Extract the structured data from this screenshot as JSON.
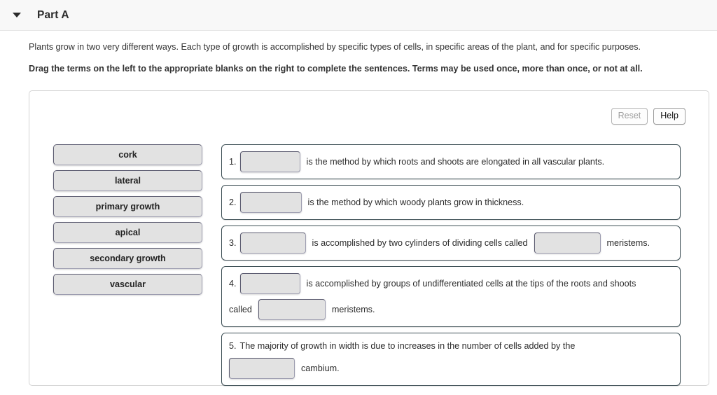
{
  "header": {
    "disclosure_icon": "chevron-down-icon",
    "title": "Part A"
  },
  "intro": {
    "paragraph": "Plants grow in two very different ways. Each type of growth is accomplished by specific types of cells, in specific areas of the plant, and for specific purposes.",
    "instruction": "Drag the terms on the left to the appropriate blanks on the right to complete the sentences. Terms may be used once, more than once, or not at all."
  },
  "toolbar": {
    "reset_label": "Reset",
    "help_label": "Help"
  },
  "term_bank": {
    "terms": [
      {
        "label": "cork"
      },
      {
        "label": "lateral"
      },
      {
        "label": "primary growth"
      },
      {
        "label": "apical"
      },
      {
        "label": "secondary growth"
      },
      {
        "label": "vascular"
      }
    ]
  },
  "sentences": [
    {
      "number": "1.",
      "blank1_value": "",
      "text1": "is the method by which roots and shoots are elongated in all vascular plants."
    },
    {
      "number": "2.",
      "blank1_value": "",
      "text1": "is the method by which woody plants grow in thickness."
    },
    {
      "number": "3.",
      "blank1_value": "",
      "text1": "is accomplished by two cylinders of dividing cells called",
      "blank2_value": "",
      "text2": "meristems."
    },
    {
      "number": "4.",
      "blank1_value": "",
      "text1": "is accomplished by groups of undifferentiated cells at the tips of the roots and shoots",
      "text_lead2": "called",
      "blank2_value": "",
      "text2": "meristems."
    },
    {
      "number": "5.",
      "text1": "The majority of growth in width is due to increases in the number of cells added by the",
      "blank1_value": "",
      "text2": "cambium."
    }
  ]
}
